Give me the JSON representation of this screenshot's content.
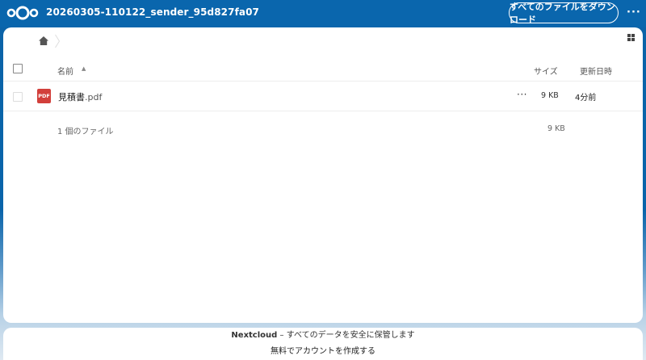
{
  "header": {
    "share_title": "20260305-110122_sender_95d827fa07",
    "download_all_label": "すべてのファイルをダウンロード",
    "more_label": "···",
    "logo_icon": "nextcloud-logo"
  },
  "toolbar": {
    "home_icon": "home-icon",
    "view_toggle_icon": "grid-view-icon"
  },
  "table": {
    "headers": {
      "name": "名前",
      "size": "サイズ",
      "modified": "更新日時"
    },
    "sort_indicator": "▲",
    "rows": [
      {
        "icon_label": "PDF",
        "name": "見積書",
        "ext": ".pdf",
        "actions": "···",
        "size": "9 KB",
        "modified": "4分前"
      }
    ],
    "summary": {
      "count": "1 個のファイル",
      "size": "9 KB"
    }
  },
  "footer": {
    "brand": "Nextcloud",
    "tagline": " – すべてのデータを安全に保管します",
    "signup_link": "無料でアカウントを作成する"
  },
  "colors": {
    "header_bg": "#0a66ad",
    "pdf_red": "#d23f3b"
  }
}
